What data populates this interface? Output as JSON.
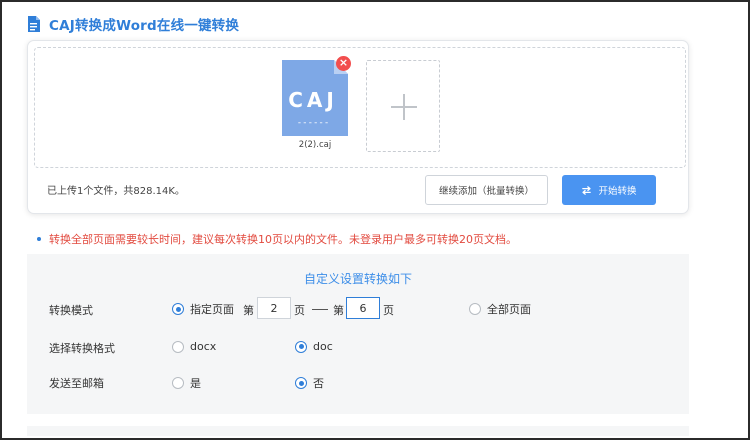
{
  "header": {
    "title": "CAJ转换成Word在线一键转换",
    "icon": "document-icon",
    "accent_color": "#2f7ed8"
  },
  "upload": {
    "file": {
      "thumb_label": "CAJ",
      "thumb_dashes": "------",
      "name": "2(2).caj",
      "remove_symbol": "×"
    },
    "status_text": "已上传1个文件，共828.14K。",
    "continue_button": "继续添加（批量转换）",
    "start_button": "开始转换",
    "start_button_color": "#4a94f1"
  },
  "notice": {
    "text": "转换全部页面需要较长时间，建议每次转换10页以内的文件。未登录用户最多可转换20页文档。",
    "color": "#e24a3f"
  },
  "settings": {
    "title": "自定义设置转换如下",
    "mode": {
      "label": "转换模式",
      "specified_label": "指定页面",
      "specified_selected": true,
      "from_prefix": "第",
      "from_value": "2",
      "from_suffix": "页",
      "separator": "—",
      "to_prefix": "第",
      "to_value": "6",
      "to_suffix": "页",
      "all_label": "全部页面",
      "all_selected": false
    },
    "format": {
      "label": "选择转换格式",
      "options": [
        {
          "label": "docx",
          "selected": false
        },
        {
          "label": "doc",
          "selected": true
        }
      ]
    },
    "email": {
      "label": "发送至邮箱",
      "options": [
        {
          "label": "是",
          "selected": false
        },
        {
          "label": "否",
          "selected": true
        }
      ]
    }
  }
}
